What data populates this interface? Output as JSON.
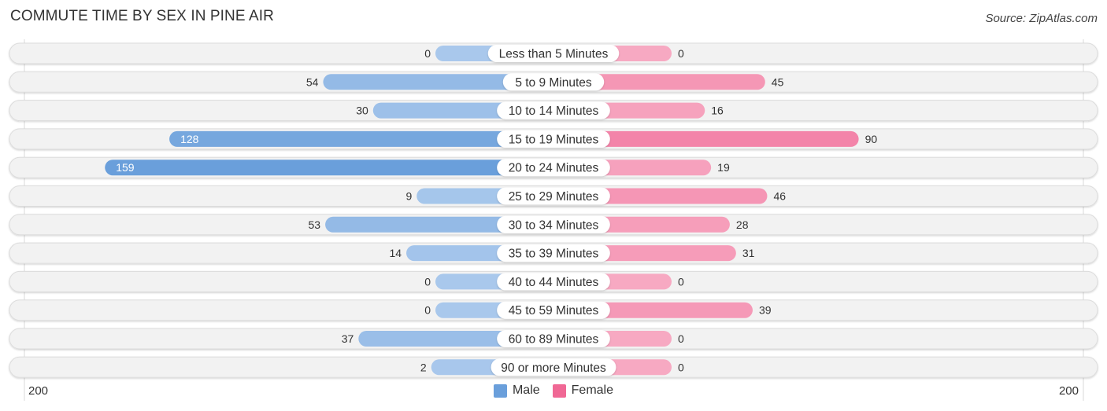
{
  "title": "COMMUTE TIME BY SEX IN PINE AIR",
  "source": "Source: ZipAtlas.com",
  "axis": {
    "left_label": "200",
    "right_label": "200"
  },
  "legend": [
    {
      "label": "Male",
      "color": "#6a9fdb"
    },
    {
      "label": "Female",
      "color": "#f06895"
    }
  ],
  "chart_data": {
    "type": "bar",
    "orientation": "horizontal-diverging",
    "title": "COMMUTE TIME BY SEX IN PINE AIR",
    "categories": [
      "Less than 5 Minutes",
      "5 to 9 Minutes",
      "10 to 14 Minutes",
      "15 to 19 Minutes",
      "20 to 24 Minutes",
      "25 to 29 Minutes",
      "30 to 34 Minutes",
      "35 to 39 Minutes",
      "40 to 44 Minutes",
      "45 to 59 Minutes",
      "60 to 89 Minutes",
      "90 or more Minutes"
    ],
    "series": [
      {
        "name": "Male",
        "values": [
          0,
          54,
          30,
          128,
          159,
          9,
          53,
          14,
          0,
          0,
          37,
          2
        ]
      },
      {
        "name": "Female",
        "values": [
          0,
          45,
          16,
          90,
          19,
          46,
          28,
          31,
          0,
          39,
          0,
          0
        ]
      }
    ],
    "xlim": [
      -200,
      200
    ],
    "xlabel": "",
    "ylabel": "",
    "legend_position": "bottom-center",
    "colors": {
      "male_light": "#a9c8ec",
      "male_dark": "#6a9fdb",
      "female_light": "#f7a9c2",
      "female_dark": "#f06895"
    }
  }
}
